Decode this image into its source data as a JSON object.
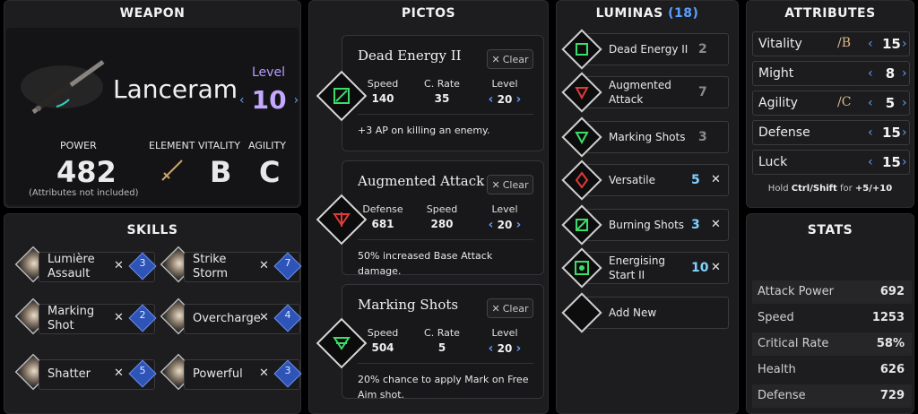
{
  "colors": {
    "accent": "#5aa0ff",
    "level": "#c4a8ff",
    "green_picto": "#3ddc6a",
    "red_picto": "#e03a3a",
    "skill_badge": "#2f54b8"
  },
  "weapon": {
    "title": "WEAPON",
    "name": "Lanceram",
    "level_label": "Level",
    "level": "10",
    "power_label": "POWER",
    "power": "482",
    "power_note": "(Attributes not included)",
    "element_label": "ELEMENT",
    "vitality_label": "VITALITY",
    "vitality_grade": "B",
    "agility_label": "AGILITY",
    "agility_grade": "C"
  },
  "skills": {
    "title": "SKILLS",
    "items": [
      {
        "name": "Lumière Assault",
        "cost": "3"
      },
      {
        "name": "Strike Storm",
        "cost": "7"
      },
      {
        "name": "Marking Shot",
        "cost": "2"
      },
      {
        "name": "Overcharge",
        "cost": "4"
      },
      {
        "name": "Shatter",
        "cost": "5"
      },
      {
        "name": "Powerful",
        "cost": "3"
      }
    ]
  },
  "pictos": {
    "title": "PICTOS",
    "clear_label": "Clear",
    "level_label": "Level",
    "items": [
      {
        "name": "Dead Energy II",
        "stat1_label": "Speed",
        "stat1_value": "140",
        "stat2_label": "C. Rate",
        "stat2_value": "35",
        "level": "20",
        "desc": "+3 AP on killing an enemy.",
        "color": "green"
      },
      {
        "name": "Augmented Attack",
        "stat1_label": "Defense",
        "stat1_value": "681",
        "stat2_label": "Speed",
        "stat2_value": "280",
        "level": "20",
        "desc": "50% increased Base Attack damage.",
        "color": "red"
      },
      {
        "name": "Marking Shots",
        "stat1_label": "Speed",
        "stat1_value": "504",
        "stat2_label": "C. Rate",
        "stat2_value": "5",
        "level": "20",
        "desc": "20% chance to apply Mark on Free Aim shot.",
        "color": "green"
      }
    ]
  },
  "luminas": {
    "title": "LUMINAS",
    "count": "(18)",
    "items": [
      {
        "name": "Dead Energy II",
        "cost": "2",
        "active": false,
        "color": "green"
      },
      {
        "name": "Augmented Attack",
        "cost": "7",
        "active": false,
        "color": "red"
      },
      {
        "name": "Marking Shots",
        "cost": "3",
        "active": false,
        "color": "green"
      },
      {
        "name": "Versatile",
        "cost": "5",
        "active": true,
        "color": "red"
      },
      {
        "name": "Burning Shots",
        "cost": "3",
        "active": true,
        "color": "green"
      },
      {
        "name": "Energising Start II",
        "cost": "10",
        "active": true,
        "color": "green"
      }
    ],
    "add_new": "Add New"
  },
  "attributes": {
    "title": "ATTRIBUTES",
    "items": [
      {
        "name": "Vitality",
        "grade": "B",
        "value": "15"
      },
      {
        "name": "Might",
        "grade": "",
        "value": "8"
      },
      {
        "name": "Agility",
        "grade": "C",
        "value": "5"
      },
      {
        "name": "Defense",
        "grade": "",
        "value": "15"
      },
      {
        "name": "Luck",
        "grade": "",
        "value": "15"
      }
    ],
    "hint_pre": "Hold",
    "hint_key": "Ctrl/Shift",
    "hint_mid": "for",
    "hint_val": "+5/+10"
  },
  "stats": {
    "title": "STATS",
    "items": [
      {
        "name": "Attack Power",
        "value": "692"
      },
      {
        "name": "Speed",
        "value": "1253"
      },
      {
        "name": "Critical Rate",
        "value": "58%"
      },
      {
        "name": "Health",
        "value": "626"
      },
      {
        "name": "Defense",
        "value": "729"
      }
    ]
  }
}
